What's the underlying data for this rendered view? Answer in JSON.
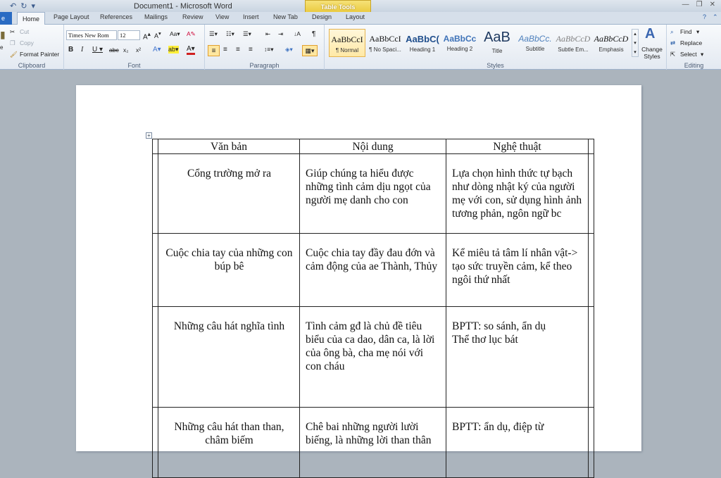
{
  "window": {
    "title": "Document1 - Microsoft Word",
    "context_tools": "Table Tools"
  },
  "tabs": {
    "file": "e",
    "home": "Home",
    "others": [
      "Page Layout",
      "References",
      "Mailings",
      "Review",
      "View",
      "Insert",
      "New Tab",
      "Design",
      "Layout"
    ]
  },
  "ribbon": {
    "clipboard": {
      "cut": "Cut",
      "copy": "Copy",
      "format_painter": "Format Painter",
      "label": "Clipboard"
    },
    "font": {
      "name": "Times New Rom",
      "size": "12",
      "label": "Font"
    },
    "paragraph": {
      "label": "Paragraph"
    },
    "styles": {
      "label": "Styles",
      "items": [
        {
          "sample": "AaBbCcI",
          "name": "¶ Normal"
        },
        {
          "sample": "AaBbCcI",
          "name": "¶ No Spaci..."
        },
        {
          "sample": "AaBbC(",
          "name": "Heading 1"
        },
        {
          "sample": "AaBbCc",
          "name": "Heading 2"
        },
        {
          "sample": "AaB",
          "name": "Title"
        },
        {
          "sample": "AaBbCc.",
          "name": "Subtitle"
        },
        {
          "sample": "AaBbCcD",
          "name": "Subtle Em..."
        },
        {
          "sample": "AaBbCcD",
          "name": "Emphasis"
        }
      ],
      "change_styles": "Change Styles"
    },
    "editing": {
      "find": "Find",
      "replace": "Replace",
      "select": "Select",
      "label": "Editing"
    }
  },
  "table": {
    "headers": [
      "Văn bản",
      "Nội dung",
      "Nghệ thuật"
    ],
    "rows": [
      [
        "Cổng trường mở ra",
        "Giúp chúng ta hiểu được những tình cảm dịu ngọt của người mẹ danh cho con",
        "Lựa chọn hình thức tự bạch như dòng nhật ký của người mẹ với con, sử dụng hình ảnh tương phản, ngôn ngữ bc"
      ],
      [
        "Cuộc chia tay của những con búp bê",
        "Cuộc chia tay đầy đau đớn và cảm động của ae Thành, Thủy",
        "Kể miêu tả tâm lí nhân vật-> tạo sức truyền cảm, kể theo ngôi thứ nhất"
      ],
      [
        "Những câu hát nghĩa tình",
        "Tình cảm gđ là chủ đề tiêu biểu của ca dao, dân ca, là lời của ông bà, cha mẹ nói với con cháu",
        "BPTT: so sánh, ẩn dụ\nThể thơ lục bát"
      ],
      [
        "Những câu hát than than, châm biếm",
        "Chê bai những người lười biếng, là những lời than thân",
        "BPTT: ẩn dụ, điệp từ"
      ]
    ]
  }
}
